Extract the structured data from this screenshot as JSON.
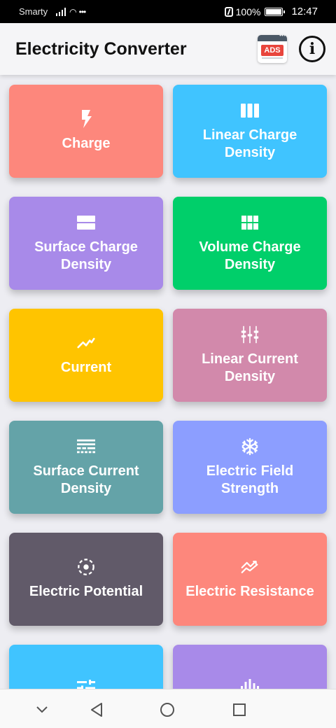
{
  "status_bar": {
    "carrier": "Smarty",
    "battery": "100%",
    "time": "12:47"
  },
  "app_bar": {
    "title": "Electricity Converter",
    "ads_label": "ADS",
    "info_glyph": "i"
  },
  "colors": {
    "salmon": "#fd877c",
    "sky": "#40c4ff",
    "lavender": "#a88ae9",
    "green": "#00cf6a",
    "amber": "#ffc400",
    "mauve": "#d289ab",
    "teal": "#64a3a8",
    "periwinkle": "#8c9eff",
    "slate": "#615a69"
  },
  "cards": [
    {
      "label": "Charge",
      "icon": "bolt-icon",
      "color": "#fd877c"
    },
    {
      "label": "Linear Charge Density",
      "icon": "view-column-icon",
      "color": "#40c4ff"
    },
    {
      "label": "Surface Charge Density",
      "icon": "view-stream-icon",
      "color": "#a88ae9"
    },
    {
      "label": "Volume Charge Density",
      "icon": "view-module-icon",
      "color": "#00cf6a"
    },
    {
      "label": "Current",
      "icon": "trending-icon",
      "color": "#ffc400"
    },
    {
      "label": "Linear Current Density",
      "icon": "fuse-icon",
      "color": "#d289ab"
    },
    {
      "label": "Surface Current Density",
      "icon": "texture-lines-icon",
      "color": "#64a3a8"
    },
    {
      "label": "Electric Field Strength",
      "icon": "snowflake-icon",
      "color": "#8c9eff"
    },
    {
      "label": "Electric Potential",
      "icon": "target-dashed-icon",
      "color": "#615a69"
    },
    {
      "label": "Electric Resistance",
      "icon": "multiline-chart-icon",
      "color": "#fd877c"
    },
    {
      "label": "",
      "icon": "tune-icon",
      "color": "#40c4ff"
    },
    {
      "label": "",
      "icon": "graphic-eq-icon",
      "color": "#a88ae9"
    }
  ],
  "nav_bar": {
    "buttons": [
      "chevron-down-icon",
      "back-triangle-icon",
      "home-circle-icon",
      "recents-square-icon"
    ]
  }
}
